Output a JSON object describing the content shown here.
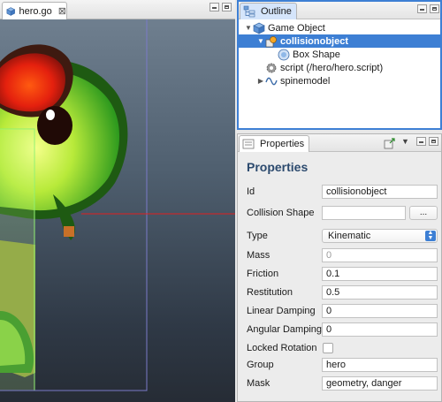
{
  "editor": {
    "tab_label": "hero.go",
    "close_glyph": "⊠",
    "accent_red": "#e02020"
  },
  "outline": {
    "tab_label": "Outline",
    "nodes": [
      {
        "label": "Game Object",
        "icon": "cube-icon",
        "expanded": true,
        "depth": 0
      },
      {
        "label": "collisionobject",
        "icon": "collision-object-icon",
        "expanded": true,
        "depth": 1,
        "selected": true
      },
      {
        "label": "Box Shape",
        "icon": "shape-icon",
        "depth": 2
      },
      {
        "label": "script (/hero/hero.script)",
        "icon": "gear-icon",
        "depth": 1
      },
      {
        "label": "spinemodel",
        "icon": "spine-icon",
        "expanded": false,
        "depth": 1
      }
    ]
  },
  "properties": {
    "tab_label": "Properties",
    "heading": "Properties",
    "fields": {
      "id": {
        "label": "Id",
        "value": "collisionobject"
      },
      "collision_shape": {
        "label": "Collision Shape",
        "value": "",
        "button": "..."
      },
      "type": {
        "label": "Type",
        "value": "Kinematic"
      },
      "mass": {
        "label": "Mass",
        "value": "0"
      },
      "friction": {
        "label": "Friction",
        "value": "0.1"
      },
      "restitution": {
        "label": "Restitution",
        "value": "0.5"
      },
      "linear_damping": {
        "label": "Linear Damping",
        "value": "0"
      },
      "angular_damping": {
        "label": "Angular Damping",
        "value": "0"
      },
      "locked_rotation": {
        "label": "Locked Rotation",
        "checked": false
      },
      "group": {
        "label": "Group",
        "value": "hero"
      },
      "mask": {
        "label": "Mask",
        "value": "geometry, danger"
      }
    }
  }
}
